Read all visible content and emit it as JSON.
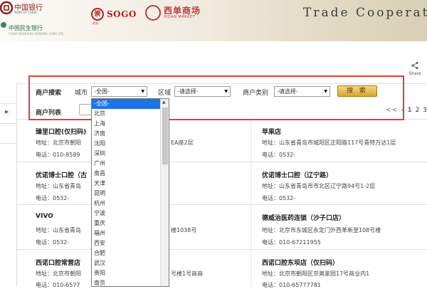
{
  "banner": {
    "boc_name": "中国银行",
    "boc_sub": "BANK OF CHINA",
    "minsheng_name": "中国民生银行",
    "minsheng_sub": "CHINA MINSHENG BANKING CORP.,LTD.",
    "sogo_mark": "崇",
    "sogo_word": "SOGO",
    "sogo_sub": "崇光",
    "xidan_name": "西单商场",
    "xidan_sub": "XIDAN MARKET",
    "slogan": "Trade Cooperatio"
  },
  "share": {
    "label": "Share",
    "icon": "share-icon"
  },
  "filters": {
    "section_label": "商户搜索",
    "city_label": "城市",
    "city_value": "-全国-",
    "area_label": "区域",
    "area_value": "-请选择-",
    "category_label": "商户类别",
    "category_value": "-请选择-",
    "search_button": "搜 索"
  },
  "list": {
    "title": "商户列表",
    "pager_nav": "<< ‹",
    "pages": [
      "1",
      "2",
      "3"
    ],
    "current_page": "1"
  },
  "city_options": [
    "-全国-",
    "北京",
    "上海",
    "济南",
    "沈阳",
    "深圳",
    "广州",
    "南昌",
    "天津",
    "昆明",
    "杭州",
    "宁波",
    "重庆",
    "福州",
    "西安",
    "合肥",
    "武汉",
    "贵阳",
    "南京"
  ],
  "cards": {
    "c1": {
      "name": "臻里口腔(仅扫码)",
      "addr": "地址：北京市朝阳",
      "addr_tail": "EA座2层",
      "phone": "电话：010-8589"
    },
    "c2": {
      "name": "苹果店",
      "addr": "地址：山东省青岛市城阳区正阳路117号青特万达1层",
      "phone": "电话：0532-"
    },
    "c3": {
      "name": "优诺博士口腔（古",
      "addr": "地址：山东省青岛",
      "phone": "电话：0532-"
    },
    "c4": {
      "name": "优诺博士口腔（辽宁路）",
      "addr": "地址：山东省青岛市市北区辽宁路94号1-2层",
      "phone": "电话：0532-"
    },
    "c5": {
      "name": "VIVO",
      "addr": "地址：山东省青岛",
      "addr_tail": "楼1038号",
      "phone": "电话：0532-"
    },
    "c6": {
      "name": "德威治医药连锁（沙子口店）",
      "addr": "地址：北京市东城区永定门外西革新里108号楼",
      "phone": "电话：010-67211955"
    },
    "c7": {
      "name": "西诺口腔常营店",
      "addr": "地址：北京市朝阳",
      "addr_tail": "号楼1号商商",
      "phone": "电话：010-6577"
    },
    "c8": {
      "name": "西诺口腔东坝店（仅扫码）",
      "addr": "地址：北京市朝阳区京奥家园17号商业内1",
      "phone": "电话：010-65777781"
    }
  },
  "colors": {
    "accent_red": "#e23c3c",
    "selected_blue": "#1e73e8",
    "button_gold": "#d9a534"
  }
}
